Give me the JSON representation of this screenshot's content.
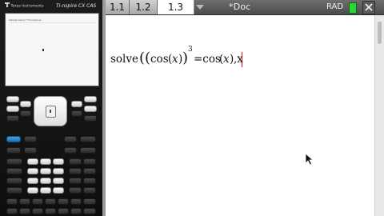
{
  "handheld": {
    "brand": "Texas Instruments",
    "model": "TI-nspire CX CAS",
    "screen_history_line": "solve((cos(x))^3=cos(x),x)"
  },
  "tabs": [
    {
      "label": "1.1",
      "active": false
    },
    {
      "label": "1.2",
      "active": false
    },
    {
      "label": "1.3",
      "active": true
    }
  ],
  "doc_title": "*Doc",
  "angle_mode": "RAD",
  "battery_color": "#2fd23a",
  "entry": {
    "solve": "solve",
    "cos1": "cos",
    "x1": "x",
    "exponent": "3",
    "equals_cos": "=cos",
    "x2": "x",
    "comma_x": ",x"
  },
  "icons": {
    "close": "close-icon",
    "dropdown": "chevron-down-icon",
    "pointer": "mouse-pointer-icon"
  }
}
